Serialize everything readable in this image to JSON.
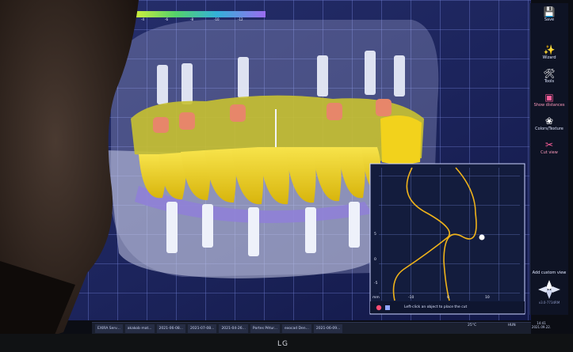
{
  "toolbar": {
    "items": [
      {
        "label": "Save",
        "icon": "save-icon",
        "glyph": "💾"
      },
      {
        "label": "Wizard",
        "icon": "wand-icon",
        "glyph": "✨"
      },
      {
        "label": "Tools",
        "icon": "tools-icon",
        "glyph": "🛠"
      },
      {
        "label": "Show distances",
        "icon": "distance-icon",
        "glyph": "▣"
      },
      {
        "label": "Colors/Texture",
        "icon": "palette-icon",
        "glyph": "❀"
      },
      {
        "label": "Cut view",
        "icon": "cut-view-icon",
        "glyph": "✂"
      },
      {
        "label": "Add custom view",
        "icon": "custom-view-icon",
        "glyph": ""
      }
    ],
    "version": "v3.0-7734RM"
  },
  "scale_bar": {
    "ticks": [
      "-4",
      "-6",
      "-8",
      "-10",
      "-12"
    ]
  },
  "cut_view": {
    "hint": "Left-click an object to place the cut",
    "x_ticks": [
      "-10",
      "0",
      "10"
    ],
    "y_ticks": [
      "5",
      "0",
      "-5"
    ],
    "unit": "mm"
  },
  "taskbar": {
    "items": [
      "EXIRA Serv...",
      "akakob mat...",
      "2021-06-08...",
      "2021-07-08...",
      "2021-04-26...",
      "Portes Pétur...",
      "exocad Den...",
      "2021-06-09..."
    ],
    "temperature": "25°C",
    "language": "HUN",
    "time": "14:41",
    "date": "2021.09.22."
  },
  "monitor": {
    "brand": "LG"
  },
  "colors": {
    "accent": "#ff5f9b",
    "grid": "#8ea0ff",
    "teeth": "#f2d21c",
    "gum": "#8f7fd8"
  }
}
